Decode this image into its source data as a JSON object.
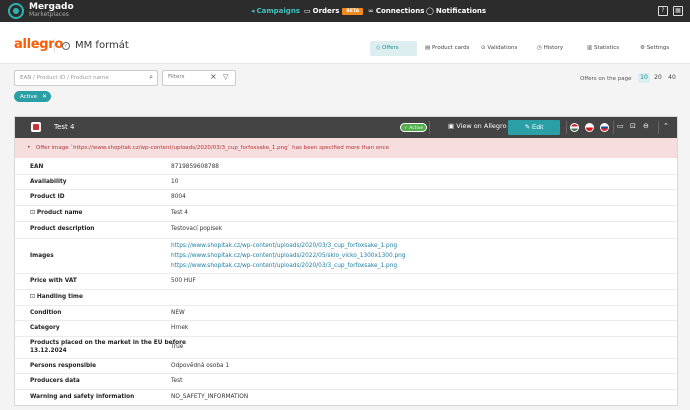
{
  "topbar": {
    "brand_line1": "Mergado",
    "brand_line2": "Marketplaces",
    "nav": {
      "campaigns": "Campaigns",
      "orders": "Orders",
      "orders_badge": "BETA",
      "connections": "Connections",
      "notifications": "Notifications"
    }
  },
  "subheader": {
    "marketplace": "allegro",
    "format_name": "MM formát",
    "tabs": [
      "Offers",
      "Product cards",
      "Validations",
      "History",
      "Statistics",
      "Settings"
    ]
  },
  "toolbar": {
    "search_placeholder": "EAN / Product ID / Product name",
    "filters_label": "Filters",
    "per_page_label": "Offers on the page",
    "per_page_options": [
      "10",
      "20",
      "40"
    ],
    "active_chip": "Active"
  },
  "offer": {
    "title": "Test 4",
    "status": "Active",
    "view_label": "View on Allegro",
    "edit_label": "Edit",
    "warning": "Offer image `https://www.shopitak.cz/wp-content/uploads/2020/03/3_cup_forfoxsake_1.png` has been specified more than once",
    "fields": {
      "ean": {
        "label": "EAN",
        "value": "8719859608788"
      },
      "availability": {
        "label": "Availability",
        "value": "10"
      },
      "product_id": {
        "label": "Product ID",
        "value": "8004"
      },
      "product_name": {
        "label": "Product name",
        "value": "Test 4"
      },
      "description": {
        "label": "Product description",
        "value": "Testovací popisek"
      },
      "images": {
        "label": "Images",
        "values": [
          "https://www.shopitak.cz/wp-content/uploads/2020/03/3_cup_forfoxsake_1.png",
          "https://www.shopitak.cz/wp-content/uploads/2022/05/sklo_vicko_1300x1300.png",
          "https://www.shopitak.cz/wp-content/uploads/2020/03/3_cup_forfoxsake_1.png"
        ]
      },
      "price": {
        "label": "Price with VAT",
        "value": "500 HUF"
      },
      "handling": {
        "label": "Handling time",
        "value": ""
      },
      "condition": {
        "label": "Condition",
        "value": "NEW"
      },
      "category": {
        "label": "Category",
        "value": "Hrnek"
      },
      "eu_market": {
        "label_line1": "Products placed on the market in the EU before",
        "label_line2": "13.12.2024",
        "value": "True"
      },
      "persons": {
        "label": "Persons responsible",
        "value": "Odpovědná osoba 1"
      },
      "producers": {
        "label": "Producers data",
        "value": "Test"
      },
      "warning_safety": {
        "label": "Warning and safety information",
        "value": "NO_SAFETY_INFORMATION"
      }
    }
  },
  "colors": {
    "accent": "#2a9fa5",
    "brand_allegro": "#ff5a00",
    "header_dark": "#2c2c2c",
    "warning_bg": "#f6dede",
    "active_green": "#4fae49"
  }
}
